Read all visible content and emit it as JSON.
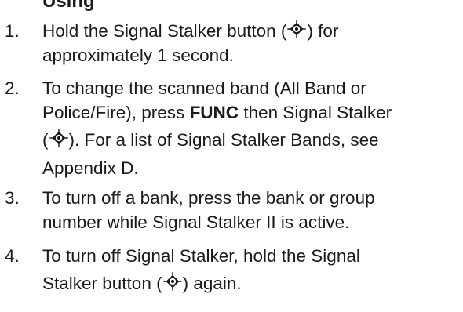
{
  "heading_fragment": "Using",
  "icon": "signal-stalker-icon",
  "steps": [
    {
      "number": "1.",
      "line1_a": "Hold the Signal Stalker button (",
      "line1_b": ") for",
      "line2": "approximately 1 second."
    },
    {
      "number": "2.",
      "line1": "To change the scanned band (All Band or",
      "line2_a": "Police/Fire), press ",
      "line2_bold": "FUNC",
      "line2_b": " then Signal Stalker",
      "line3_a": "(",
      "line3_b": "). For a list of Signal Stalker Bands, see",
      "line4": "Appendix D."
    },
    {
      "number": "3.",
      "line1": "To turn off a bank, press the bank or group",
      "line2": "number while Signal Stalker II is active."
    },
    {
      "number": "4.",
      "line1": "To turn off Signal Stalker, hold the Signal",
      "line2_a": "Stalker button (",
      "line2_b": ") again."
    }
  ]
}
